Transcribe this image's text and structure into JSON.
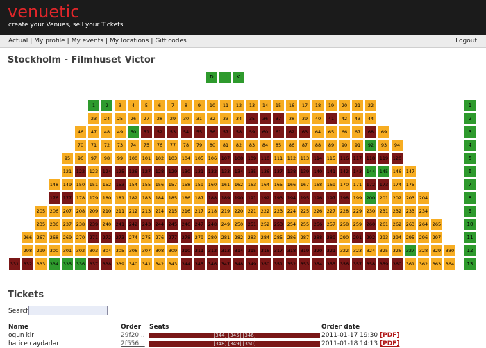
{
  "app": {
    "name": "venuetic",
    "tagline": "create your Venues, sell your Tickets"
  },
  "nav": {
    "items": [
      "Actual",
      "My profile",
      "My events",
      "My locations",
      "Gift codes"
    ],
    "logout": "Logout"
  },
  "venue": {
    "title": "Stockholm - Filmhuset Victor"
  },
  "stage_labels": [
    "D",
    "U",
    "K"
  ],
  "colors": {
    "free": "#f7ad22",
    "sold": "#7a1717",
    "reserved": "#2e9a2d"
  },
  "seat_map": {
    "rows": [
      {
        "label": "1",
        "start": 1,
        "end": 22,
        "sold": [],
        "reserved": [
          1,
          2
        ]
      },
      {
        "label": "2",
        "start": 23,
        "end": 44,
        "sold": [
          35,
          36,
          37,
          41
        ],
        "reserved": []
      },
      {
        "label": "3",
        "start": 46,
        "end": 69,
        "sold": [
          51,
          52,
          53,
          54,
          55,
          56,
          57,
          58,
          59,
          60,
          61,
          62,
          63,
          68
        ],
        "reserved": [
          50
        ]
      },
      {
        "label": "4",
        "start": 70,
        "end": 94,
        "sold": [],
        "reserved": [
          92
        ]
      },
      {
        "label": "5",
        "start": 95,
        "end": 120,
        "sold": [
          107,
          108,
          109,
          110,
          114,
          116,
          117,
          118,
          119,
          120
        ],
        "reserved": []
      },
      {
        "label": "6",
        "start": 121,
        "end": 147,
        "sold": [
          122,
          124,
          125,
          126,
          127,
          128,
          129,
          130,
          131,
          132,
          133,
          134,
          135,
          136,
          137,
          138,
          139,
          140,
          141,
          142,
          143
        ],
        "reserved": [
          144,
          145
        ]
      },
      {
        "label": "7",
        "start": 148,
        "end": 175,
        "sold": [
          153,
          172,
          173
        ],
        "reserved": []
      },
      {
        "label": "8",
        "start": 176,
        "end": 204,
        "sold": [
          176,
          177,
          188,
          189,
          190,
          191,
          192,
          193,
          194,
          195,
          196,
          197,
          198
        ],
        "reserved": [
          200
        ]
      },
      {
        "label": "9",
        "start": 205,
        "end": 234,
        "sold": [],
        "reserved": []
      },
      {
        "label": "10",
        "start": 235,
        "end": 265,
        "sold": [
          239,
          241,
          242,
          243,
          244,
          245,
          246,
          247,
          248,
          251,
          253,
          256,
          260
        ],
        "reserved": []
      },
      {
        "label": "11",
        "start": 266,
        "end": 297,
        "sold": [
          271,
          272,
          273,
          277,
          278,
          288,
          289,
          291,
          292
        ],
        "reserved": []
      },
      {
        "label": "12",
        "start": 298,
        "end": 330,
        "sold": [
          310,
          311,
          312,
          313,
          314,
          315,
          316,
          317,
          318,
          319,
          320,
          321
        ],
        "reserved": [
          327
        ]
      },
      {
        "label": "13",
        "start": 331,
        "end": 364,
        "sold": [
          331,
          332,
          337,
          338,
          344,
          345,
          346,
          347,
          348,
          349,
          350,
          351,
          352,
          353,
          354,
          355,
          356,
          357,
          358,
          359,
          360
        ],
        "reserved": [
          334,
          335,
          336
        ]
      }
    ]
  },
  "tickets": {
    "heading": "Tickets",
    "search_label": "Search",
    "search_value": "",
    "columns": [
      "Name",
      "Order",
      "Seats",
      "Order date"
    ],
    "rows": [
      {
        "name": "ogun kir",
        "order": "29f20...",
        "seats": "[344] [345] [346]",
        "date": "2011-01-17 19:30",
        "pdf": "[PDF]"
      },
      {
        "name": "hatice caydarlar",
        "order": "2f556...",
        "seats": "[348] [349] [350]",
        "date": "2011-01-18 14:13",
        "pdf": "[PDF]"
      }
    ]
  }
}
